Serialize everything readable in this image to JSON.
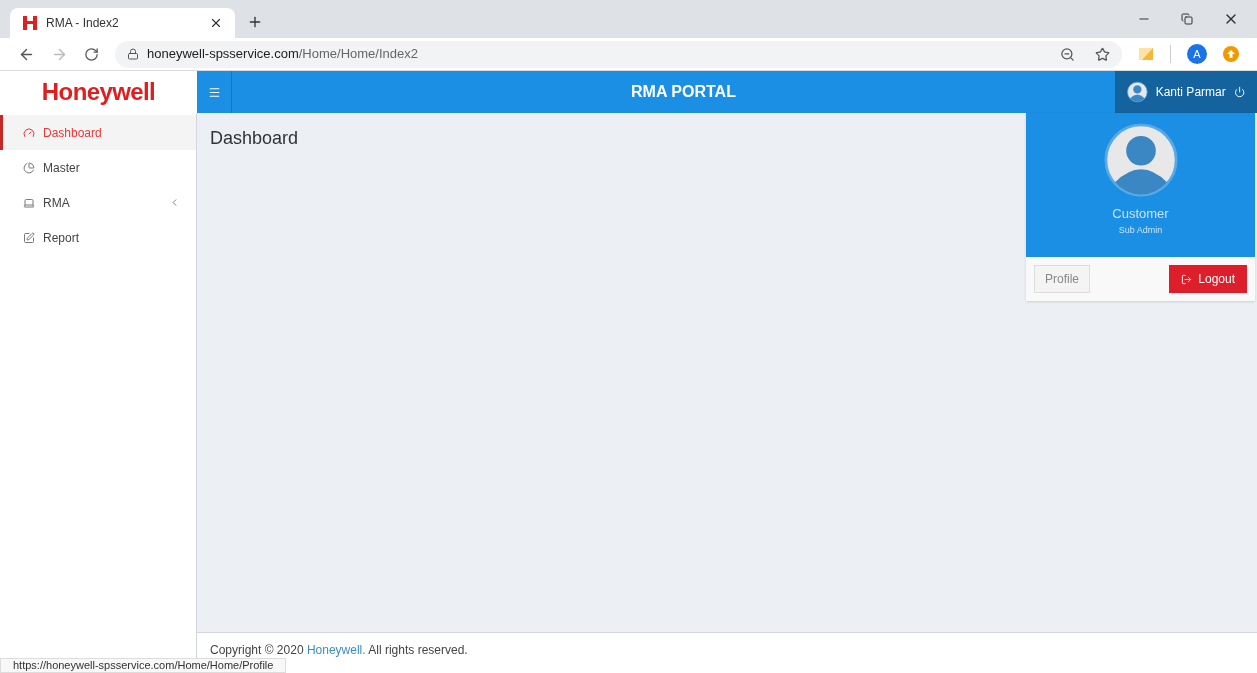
{
  "browser": {
    "tab_title": "RMA - Index2",
    "url_host": "honeywell-spsservice.com",
    "url_path": "/Home/Home/Index2",
    "profile_initial": "A",
    "status_url": "https://honeywell-spsservice.com/Home/Home/Profile"
  },
  "header": {
    "logo": "Honeywell",
    "title": "RMA PORTAL",
    "user_name": "Kanti Parmar"
  },
  "sidebar": {
    "items": [
      {
        "label": "Dashboard",
        "selected": true,
        "expandable": false
      },
      {
        "label": "Master",
        "selected": false,
        "expandable": false
      },
      {
        "label": "RMA",
        "selected": false,
        "expandable": true
      },
      {
        "label": "Report",
        "selected": false,
        "expandable": false
      }
    ]
  },
  "main": {
    "heading": "Dashboard"
  },
  "user_card": {
    "name": "Customer",
    "role": "Sub Admin",
    "profile_button": "Profile",
    "logout_button": "Logout"
  },
  "footer": {
    "prefix": "Copyright © 2020",
    "link": "Honeywell.",
    "suffix": "All rights reserved."
  }
}
